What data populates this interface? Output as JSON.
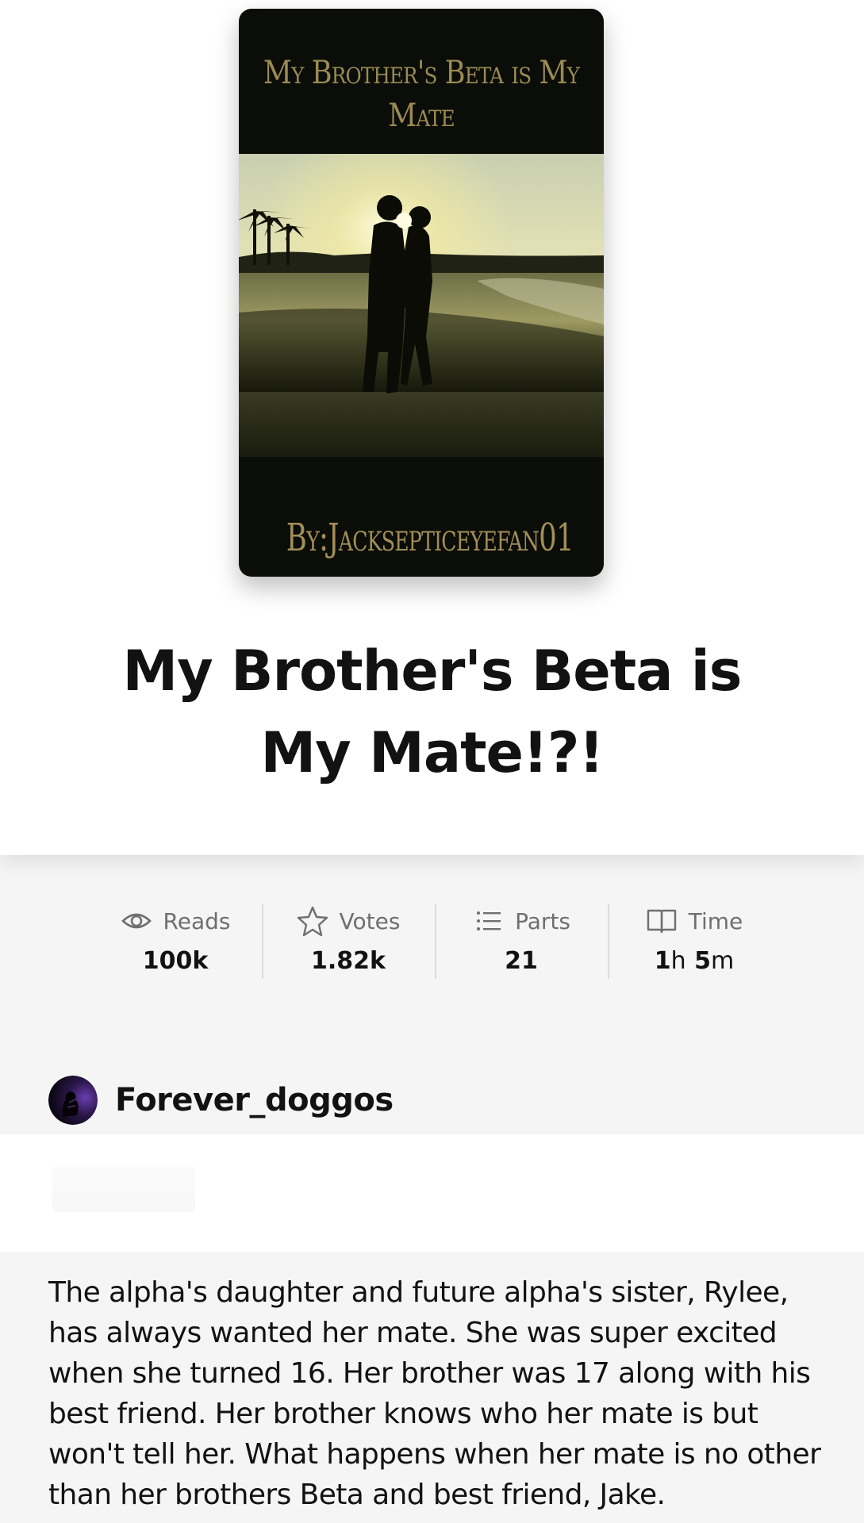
{
  "cover": {
    "title": "My Brother's Beta is My Mate",
    "author": "By:Jacksepticeyefan01"
  },
  "story": {
    "title": "My Brother's Beta is My Mate!?!"
  },
  "stats": [
    {
      "icon": "eye-icon",
      "label": "Reads",
      "value": "100k"
    },
    {
      "icon": "star-icon",
      "label": "Votes",
      "value": "1.82k"
    },
    {
      "icon": "list-icon",
      "label": "Parts",
      "value": "21"
    },
    {
      "icon": "book-icon",
      "label": "Time",
      "hours": "1",
      "hours_unit": "h",
      "minutes": "5",
      "minutes_unit": "m"
    }
  ],
  "author": {
    "name": "Forever_doggos"
  },
  "description": "The alpha's daughter and future alpha's sister, Rylee, has always wanted her mate. She was super excited when she turned 16. Her brother was 17 along with his best friend. Her brother knows who her mate is but won't tell her. What happens when her mate is no other than her brothers Beta and best friend, Jake."
}
